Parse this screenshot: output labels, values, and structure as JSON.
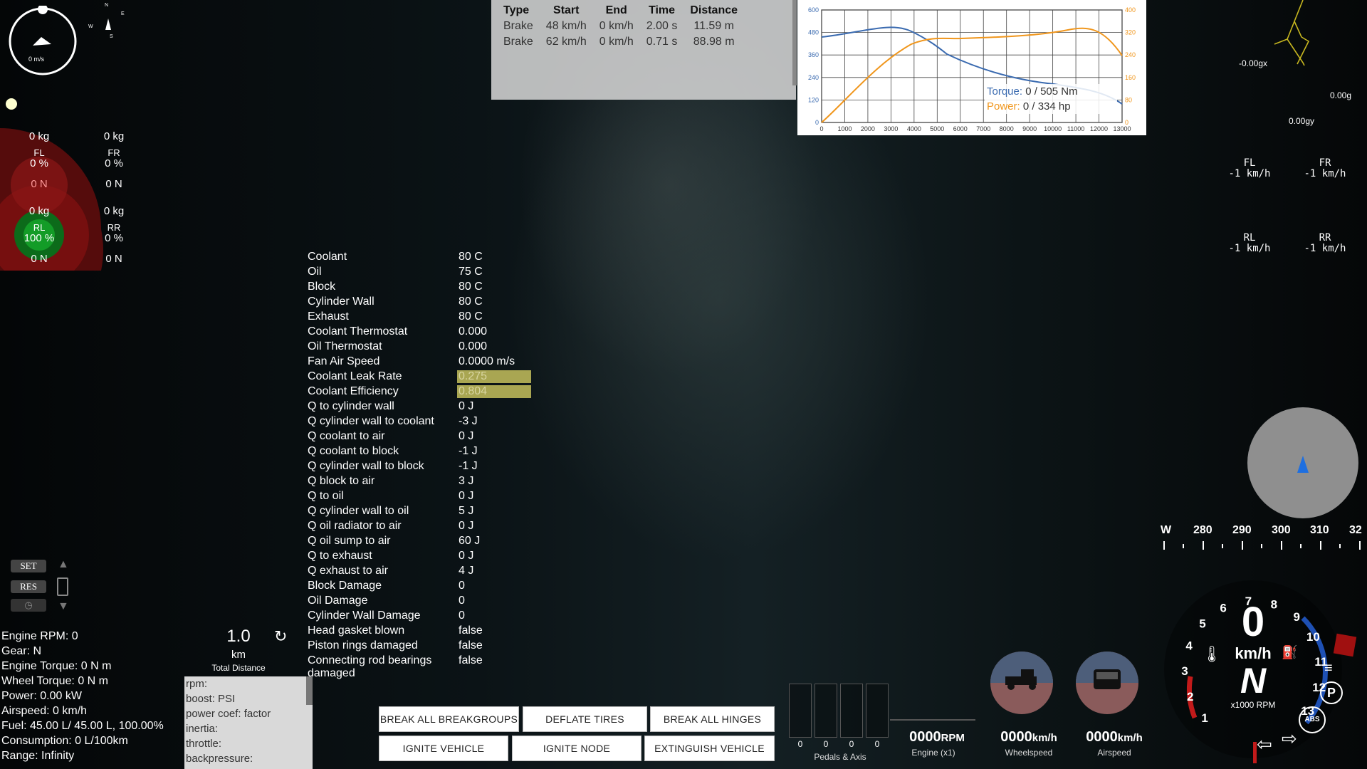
{
  "compass": {
    "speed": "0 m/s",
    "letters": [
      "N",
      "E",
      "S",
      "W"
    ]
  },
  "brake_table": {
    "headers": [
      "Type",
      "Start",
      "End",
      "Time",
      "Distance"
    ],
    "rows": [
      [
        "Brake",
        "48 km/h",
        "0 km/h",
        "2.00 s",
        "11.59 m"
      ],
      [
        "Brake",
        "62 km/h",
        "0 km/h",
        "0.71 s",
        "88.98 m"
      ]
    ]
  },
  "torque_graph": {
    "left_ticks": [
      "600",
      "480",
      "360",
      "240",
      "120",
      "0"
    ],
    "right_ticks": [
      "400",
      "320",
      "240",
      "160",
      "80",
      "0"
    ],
    "x_ticks": [
      "0",
      "1000",
      "2000",
      "3000",
      "4000",
      "5000",
      "6000",
      "7000",
      "8000",
      "9000",
      "10000",
      "11000",
      "12000",
      "13000"
    ],
    "torque_label": "Torque:",
    "torque_value": "0 / 505 Nm",
    "power_label": "Power:",
    "power_value": "0 / 334 hp",
    "torque_color": "#3b6bb0",
    "power_color": "#f0961c"
  },
  "gforce": {
    "gx": "-0.00gx",
    "g": "0.00g",
    "gy": "0.00gy"
  },
  "wheel_speeds": [
    {
      "name": "FL",
      "value": "-1 km/h"
    },
    {
      "name": "FR",
      "value": "-1 km/h"
    },
    {
      "name": "RL",
      "value": "-1 km/h"
    },
    {
      "name": "RR",
      "value": "-1 km/h"
    }
  ],
  "wheel_loads": [
    {
      "name": "FL",
      "mass": "0 kg",
      "pct": "0 %",
      "force": "0 N"
    },
    {
      "name": "FR",
      "mass": "0 kg",
      "pct": "0 %",
      "force": "0 N"
    },
    {
      "name": "RL",
      "mass": "0 kg",
      "pct": "100 %",
      "force": "0 N"
    },
    {
      "name": "RR",
      "mass": "0 kg",
      "pct": "0 %",
      "force": "0 N"
    }
  ],
  "engine_stats": [
    [
      "Coolant",
      "80 C"
    ],
    [
      "Oil",
      "75 C"
    ],
    [
      "Block",
      "80 C"
    ],
    [
      "Cylinder Wall",
      "80 C"
    ],
    [
      "Exhaust",
      "80 C"
    ],
    [
      "Coolant Thermostat",
      "0.000"
    ],
    [
      "Oil Thermostat",
      "0.000"
    ],
    [
      "Fan Air Speed",
      "0.0000 m/s"
    ],
    [
      "Coolant Leak Rate",
      "0.275"
    ],
    [
      "Coolant Efficiency",
      "0.804"
    ],
    [
      "Q to cylinder wall",
      "0 J"
    ],
    [
      "Q cylinder wall to coolant",
      "-3 J"
    ],
    [
      "Q coolant to air",
      "0 J"
    ],
    [
      "Q coolant to block",
      "-1 J"
    ],
    [
      "Q cylinder wall to block",
      "-1 J"
    ],
    [
      "Q block to air",
      "3 J"
    ],
    [
      "Q to oil",
      "0 J"
    ],
    [
      "Q cylinder wall to oil",
      "5 J"
    ],
    [
      "Q oil radiator to air",
      "0 J"
    ],
    [
      "Q oil sump to air",
      "60 J"
    ],
    [
      "Q to exhaust",
      "0 J"
    ],
    [
      "Q exhaust to air",
      "4 J"
    ],
    [
      "Block Damage",
      "0"
    ],
    [
      "Oil Damage",
      "0"
    ],
    [
      "Cylinder Wall Damage",
      "0"
    ],
    [
      "Head gasket blown",
      "false"
    ],
    [
      "Piston rings damaged",
      "false"
    ],
    [
      "Connecting rod bearings damaged",
      "false"
    ]
  ],
  "cruise": {
    "set": "SET",
    "res": "RES",
    "value": "0"
  },
  "vehicle_info": [
    "Engine RPM: 0",
    "Gear: N",
    "Engine Torque: 0 N m",
    "Wheel Torque: 0 N m",
    "Power: 0.00 kW",
    "Airspeed: 0 km/h",
    "Fuel: 45.00 L/ 45.00 L, 100.00%",
    "Consumption: 0 L/100km",
    "Range: Infinity"
  ],
  "trip": {
    "distance": "1.0",
    "unit": "km",
    "label": "Total Distance"
  },
  "debug_box": [
    "rpm:",
    "boost: PSI",
    "power coef: factor",
    "inertia:",
    "throttle:",
    "backpressure:"
  ],
  "buttons": {
    "break_breakgroups": "BREAK ALL BREAKGROUPS",
    "deflate_tires": "DEFLATE TIRES",
    "break_hinges": "BREAK ALL HINGES",
    "ignite_vehicle": "IGNITE VEHICLE",
    "ignite_node": "IGNITE NODE",
    "extinguish_vehicle": "EXTINGUISH VEHICLE"
  },
  "pedals": {
    "values": [
      "0",
      "0",
      "0",
      "0"
    ],
    "label": "Pedals & Axis"
  },
  "readouts": {
    "rpm_value": "0000",
    "rpm_unit": "RPM",
    "rpm_label": "Engine (x1)",
    "wheelspeed_value": "0000",
    "wheelspeed_unit": "km/h",
    "wheelspeed_label": "Wheelspeed",
    "airspeed_value": "0000",
    "airspeed_unit": "km/h",
    "airspeed_label": "Airspeed"
  },
  "heading_tape": [
    "W",
    "280",
    "290",
    "300",
    "310",
    "32"
  ],
  "gauge": {
    "speed": "0",
    "speed_unit": "km/h",
    "gear": "N",
    "rpm_label": "x1000 RPM",
    "ticks": [
      "1",
      "2",
      "3",
      "4",
      "5",
      "6",
      "7",
      "8",
      "9",
      "10",
      "11",
      "12",
      "13"
    ],
    "abs": "ABS",
    "park": "P"
  }
}
